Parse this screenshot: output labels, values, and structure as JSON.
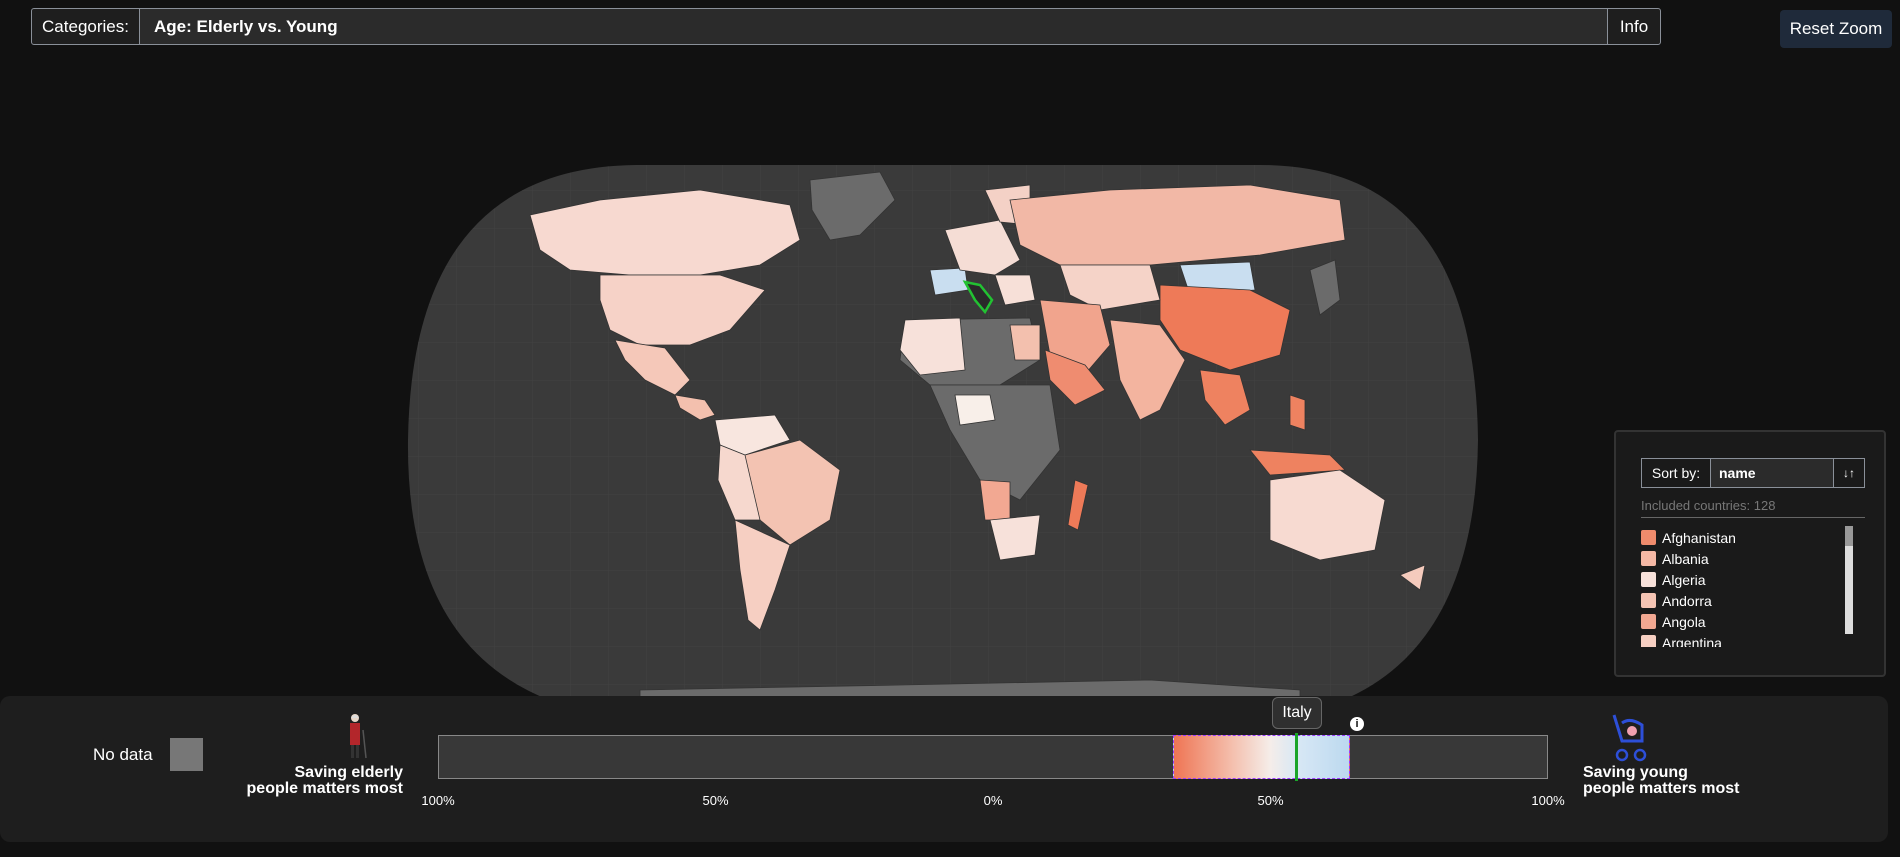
{
  "toolbar": {
    "category_label": "Categories:",
    "category_value": "Age: Elderly vs. Young",
    "info_label": "Info",
    "reset_zoom_label": "Reset Zoom"
  },
  "map": {
    "selected_country": "Italy",
    "colors": {
      "no_data": "#6b6b6b",
      "ocean": "#3a3a3a",
      "background": "#111111",
      "highlight": "#1aa52a"
    },
    "country_fills_note": ""
  },
  "sort_panel": {
    "sort_label": "Sort by:",
    "sort_value": "name",
    "sort_direction_icon": "sort-descending-icon",
    "included_text": "Included countries: 128",
    "countries": [
      {
        "name": "Afghanistan",
        "color": "#ef8b6c"
      },
      {
        "name": "Albania",
        "color": "#f4b8a5"
      },
      {
        "name": "Algeria",
        "color": "#f7e1da"
      },
      {
        "name": "Andorra",
        "color": "#f5c4b3"
      },
      {
        "name": "Angola",
        "color": "#f2a892"
      },
      {
        "name": "Argentina",
        "color": "#f6cfc2"
      }
    ]
  },
  "legend": {
    "no_data_label": "No data",
    "left_label_line1": "Saving elderly",
    "left_label_line2": "people matters most",
    "right_label_line1": "Saving young",
    "right_label_line2": "people matters most",
    "ticks": [
      "100%",
      "50%",
      "0%",
      "50%",
      "100%"
    ],
    "tooltip": "Italy",
    "range_start_fraction": 0.662,
    "range_end_fraction": 0.822,
    "marker_fraction": 0.773
  }
}
